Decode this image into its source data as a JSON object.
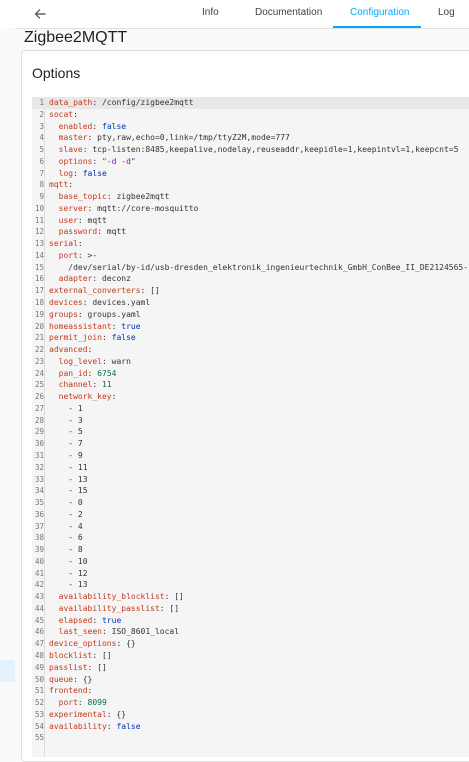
{
  "header": {
    "tabs": [
      {
        "label": "Info",
        "active": false
      },
      {
        "label": "Documentation",
        "active": false
      },
      {
        "label": "Configuration",
        "active": true
      },
      {
        "label": "Log",
        "active": false
      }
    ]
  },
  "page_title": "Zigbee2MQTT",
  "card": {
    "title": "Options"
  },
  "editor": {
    "lines": [
      "data_path: /config/zigbee2mqtt",
      "socat:",
      "  enabled: false",
      "  master: pty,raw,echo=0,link=/tmp/ttyZ2M,mode=777",
      "  slave: tcp-listen:8485,keepalive,nodelay,reuseaddr,keepidle=1,keepintvl=1,keepcnt=5",
      "  options: \"-d -d\"",
      "  log: false",
      "mqtt:",
      "  base_topic: zigbee2mqtt",
      "  server: mqtt://core-mosquitto",
      "  user: mqtt",
      "  password: mqtt",
      "serial:",
      "  port: >-",
      "    /dev/serial/by-id/usb-dresden_elektronik_ingenieurtechnik_GmbH_ConBee_II_DE2124565-if00",
      "  adapter: deconz",
      "external_converters: []",
      "devices: devices.yaml",
      "groups: groups.yaml",
      "homeassistant: true",
      "permit_join: false",
      "advanced:",
      "  log_level: warn",
      "  pan_id: 6754",
      "  channel: 11",
      "  network_key:",
      "    - 1",
      "    - 3",
      "    - 5",
      "    - 7",
      "    - 9",
      "    - 11",
      "    - 13",
      "    - 15",
      "    - 0",
      "    - 2",
      "    - 4",
      "    - 6",
      "    - 8",
      "    - 10",
      "    - 12",
      "    - 13",
      "  availability_blocklist: []",
      "  availability_passlist: []",
      "  elapsed: true",
      "  last_seen: ISO_8601_local",
      "device_options: {}",
      "blocklist: []",
      "passlist: []",
      "queue: {}",
      "frontend:",
      "  port: 8099",
      "experimental: {}",
      "availability: false",
      ""
    ]
  }
}
